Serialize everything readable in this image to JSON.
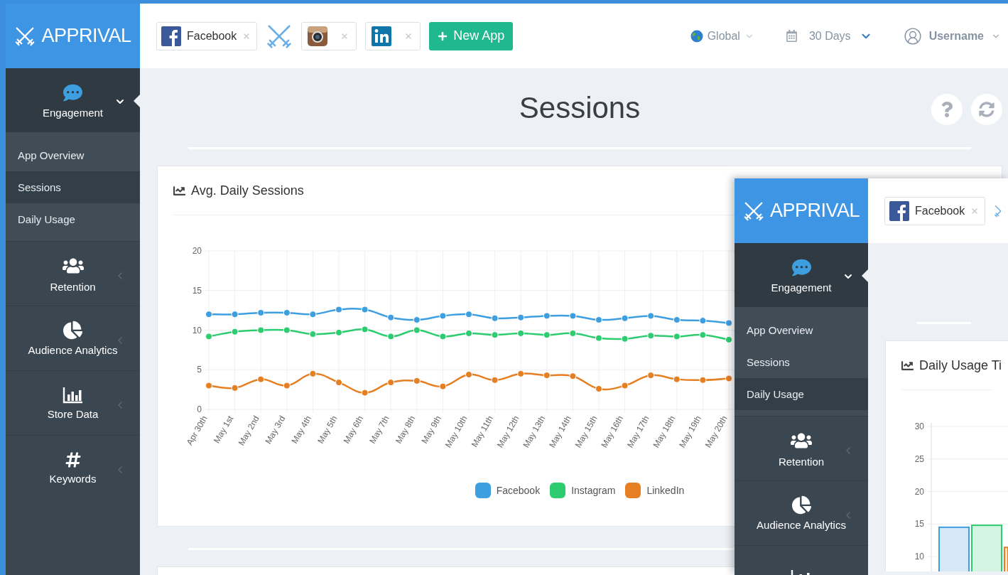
{
  "windows": [
    {
      "brand": "APPRIVAL",
      "sidebar": [
        {
          "label": "Engagement",
          "selected": true,
          "expanded": true,
          "children": [
            {
              "label": "App Overview",
              "selected": false
            },
            {
              "label": "Sessions",
              "selected": true
            },
            {
              "label": "Daily Usage",
              "selected": false
            }
          ]
        },
        {
          "label": "Retention",
          "selected": false,
          "expanded": false
        },
        {
          "label": "Audience Analytics",
          "selected": false,
          "expanded": false
        },
        {
          "label": "Store Data",
          "selected": false,
          "expanded": false
        },
        {
          "label": "Keywords",
          "selected": false,
          "expanded": false
        }
      ],
      "apps": [
        {
          "kind": "facebook",
          "label": "Facebook"
        },
        {
          "kind": "swords"
        },
        {
          "kind": "instagram"
        },
        {
          "kind": "linkedin"
        }
      ],
      "new_app_button": "New App",
      "region": "Global",
      "period": "30 Days",
      "user": "Username",
      "page_title": "Sessions",
      "cards": [
        {
          "title": "Avg. Daily Sessions",
          "chart_data": {
            "type": "line",
            "categories": [
              "Apr 30th",
              "May 1st",
              "May 2nd",
              "May 3rd",
              "May 4th",
              "May 5th",
              "May 6th",
              "May 7th",
              "May 8th",
              "May 9th",
              "May 10th",
              "May 11th",
              "May 12th",
              "May 13th",
              "May 14th",
              "May 15th",
              "May 16th",
              "May 17th",
              "May 18th",
              "May 19th",
              "May 20th"
            ],
            "ylim": [
              0,
              20
            ],
            "yticks": [
              0,
              5,
              10,
              15,
              20
            ],
            "grid": true,
            "series": [
              {
                "name": "Facebook",
                "color": "#3d9ee0",
                "marker": true,
                "values": [
                  12,
                  12,
                  12.2,
                  12.2,
                  12,
                  12.6,
                  12.6,
                  11.6,
                  11.3,
                  11.8,
                  12,
                  11.5,
                  11.6,
                  11.8,
                  11.8,
                  11.3,
                  11.5,
                  11.8,
                  11.3,
                  11.2,
                  10.9
                ]
              },
              {
                "name": "Instagram",
                "color": "#2ecc71",
                "marker": true,
                "values": [
                  9.2,
                  9.8,
                  10,
                  10,
                  9.5,
                  9.7,
                  10.1,
                  9.2,
                  10,
                  9.2,
                  9.6,
                  9.4,
                  9.6,
                  9.4,
                  9.6,
                  9,
                  8.9,
                  9.3,
                  9.2,
                  9.4,
                  8.8
                ]
              },
              {
                "name": "LinkedIn",
                "color": "#e67e22",
                "marker": true,
                "values": [
                  3,
                  2.7,
                  3.8,
                  3,
                  4.5,
                  3.4,
                  2.1,
                  3.4,
                  3.6,
                  2.9,
                  4.4,
                  3.7,
                  4.5,
                  4.3,
                  4.2,
                  2.6,
                  3,
                  4.3,
                  3.8,
                  3.7,
                  3.9
                ]
              }
            ]
          }
        }
      ]
    },
    {
      "brand": "APPRIVAL",
      "sidebar": [
        {
          "label": "Engagement",
          "selected": true,
          "expanded": true,
          "children": [
            {
              "label": "App Overview",
              "selected": false
            },
            {
              "label": "Sessions",
              "selected": false
            },
            {
              "label": "Daily Usage",
              "selected": true
            }
          ]
        },
        {
          "label": "Retention",
          "selected": false,
          "expanded": false
        },
        {
          "label": "Audience Analytics",
          "selected": false,
          "expanded": false
        },
        {
          "selected": false,
          "expanded": false
        }
      ],
      "apps": [
        {
          "kind": "facebook",
          "label": "Facebook"
        },
        {
          "kind": "swords"
        }
      ],
      "cards": [
        {
          "title": "Daily Usage Ti",
          "chart_data": {
            "type": "bar",
            "ylim": [
              7.5,
              30
            ],
            "yticks": [
              10,
              15,
              20,
              25,
              30
            ],
            "grid": true,
            "stacked": false,
            "series": [
              {
                "color": "#3d9ee0",
                "values": [
                  14.5
                ]
              },
              {
                "color": "#2ecc71",
                "values": [
                  14.8
                ]
              },
              {
                "color": "#e67e22",
                "values": [
                  11.4
                ]
              }
            ]
          }
        }
      ]
    }
  ]
}
